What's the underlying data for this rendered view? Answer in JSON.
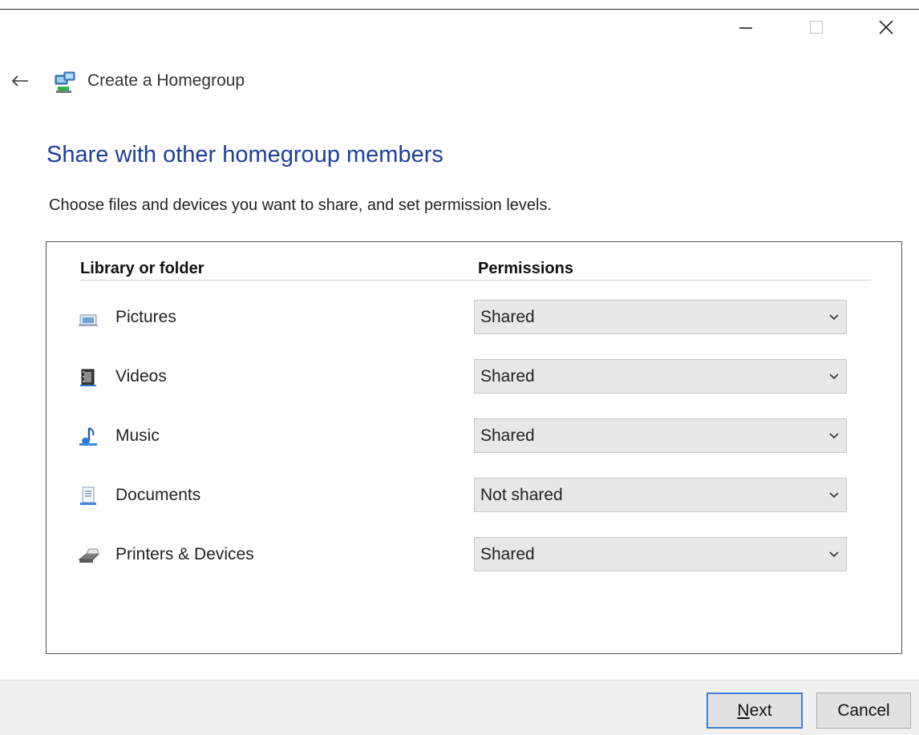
{
  "window": {
    "title": "Create a Homegroup",
    "controls": {
      "minimize": "minimize",
      "maximize": "maximize",
      "close": "close"
    }
  },
  "page": {
    "heading": "Share with other homegroup members",
    "instructions": "Choose files and devices you want to share, and set permission levels."
  },
  "table": {
    "columns": [
      "Library or folder",
      "Permissions"
    ],
    "rows": [
      {
        "label": "Pictures",
        "icon": "pictures-library-icon",
        "permission": "Shared"
      },
      {
        "label": "Videos",
        "icon": "videos-library-icon",
        "permission": "Shared"
      },
      {
        "label": "Music",
        "icon": "music-library-icon",
        "permission": "Shared"
      },
      {
        "label": "Documents",
        "icon": "documents-library-icon",
        "permission": "Not shared"
      },
      {
        "label": "Printers & Devices",
        "icon": "printer-icon",
        "permission": "Shared"
      }
    ]
  },
  "footer": {
    "next_label": "Next",
    "cancel_label": "Cancel"
  },
  "colors": {
    "heading": "#1e3f9a",
    "next_focus_border": "#3b83d6",
    "select_bg": "#e8e8e8",
    "footer_bg": "#f0f0f0"
  }
}
